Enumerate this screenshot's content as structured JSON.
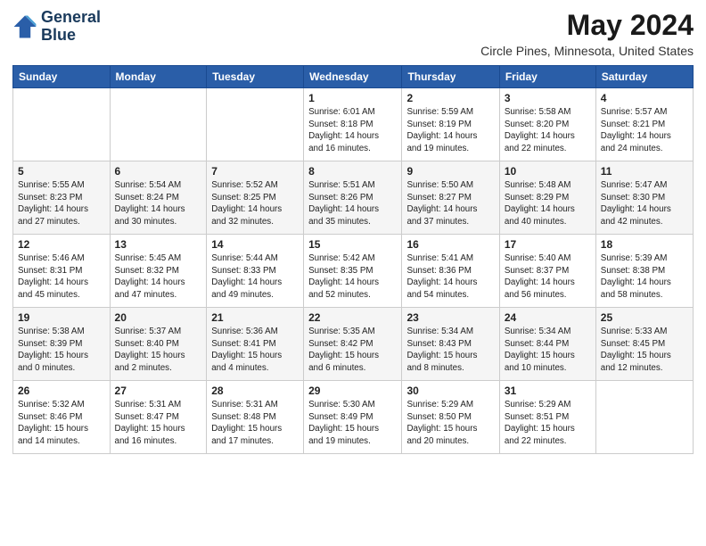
{
  "logo": {
    "line1": "General",
    "line2": "Blue"
  },
  "title": "May 2024",
  "subtitle": "Circle Pines, Minnesota, United States",
  "days_of_week": [
    "Sunday",
    "Monday",
    "Tuesday",
    "Wednesday",
    "Thursday",
    "Friday",
    "Saturday"
  ],
  "weeks": [
    [
      {
        "day": "",
        "info": ""
      },
      {
        "day": "",
        "info": ""
      },
      {
        "day": "",
        "info": ""
      },
      {
        "day": "1",
        "info": "Sunrise: 6:01 AM\nSunset: 8:18 PM\nDaylight: 14 hours\nand 16 minutes."
      },
      {
        "day": "2",
        "info": "Sunrise: 5:59 AM\nSunset: 8:19 PM\nDaylight: 14 hours\nand 19 minutes."
      },
      {
        "day": "3",
        "info": "Sunrise: 5:58 AM\nSunset: 8:20 PM\nDaylight: 14 hours\nand 22 minutes."
      },
      {
        "day": "4",
        "info": "Sunrise: 5:57 AM\nSunset: 8:21 PM\nDaylight: 14 hours\nand 24 minutes."
      }
    ],
    [
      {
        "day": "5",
        "info": "Sunrise: 5:55 AM\nSunset: 8:23 PM\nDaylight: 14 hours\nand 27 minutes."
      },
      {
        "day": "6",
        "info": "Sunrise: 5:54 AM\nSunset: 8:24 PM\nDaylight: 14 hours\nand 30 minutes."
      },
      {
        "day": "7",
        "info": "Sunrise: 5:52 AM\nSunset: 8:25 PM\nDaylight: 14 hours\nand 32 minutes."
      },
      {
        "day": "8",
        "info": "Sunrise: 5:51 AM\nSunset: 8:26 PM\nDaylight: 14 hours\nand 35 minutes."
      },
      {
        "day": "9",
        "info": "Sunrise: 5:50 AM\nSunset: 8:27 PM\nDaylight: 14 hours\nand 37 minutes."
      },
      {
        "day": "10",
        "info": "Sunrise: 5:48 AM\nSunset: 8:29 PM\nDaylight: 14 hours\nand 40 minutes."
      },
      {
        "day": "11",
        "info": "Sunrise: 5:47 AM\nSunset: 8:30 PM\nDaylight: 14 hours\nand 42 minutes."
      }
    ],
    [
      {
        "day": "12",
        "info": "Sunrise: 5:46 AM\nSunset: 8:31 PM\nDaylight: 14 hours\nand 45 minutes."
      },
      {
        "day": "13",
        "info": "Sunrise: 5:45 AM\nSunset: 8:32 PM\nDaylight: 14 hours\nand 47 minutes."
      },
      {
        "day": "14",
        "info": "Sunrise: 5:44 AM\nSunset: 8:33 PM\nDaylight: 14 hours\nand 49 minutes."
      },
      {
        "day": "15",
        "info": "Sunrise: 5:42 AM\nSunset: 8:35 PM\nDaylight: 14 hours\nand 52 minutes."
      },
      {
        "day": "16",
        "info": "Sunrise: 5:41 AM\nSunset: 8:36 PM\nDaylight: 14 hours\nand 54 minutes."
      },
      {
        "day": "17",
        "info": "Sunrise: 5:40 AM\nSunset: 8:37 PM\nDaylight: 14 hours\nand 56 minutes."
      },
      {
        "day": "18",
        "info": "Sunrise: 5:39 AM\nSunset: 8:38 PM\nDaylight: 14 hours\nand 58 minutes."
      }
    ],
    [
      {
        "day": "19",
        "info": "Sunrise: 5:38 AM\nSunset: 8:39 PM\nDaylight: 15 hours\nand 0 minutes."
      },
      {
        "day": "20",
        "info": "Sunrise: 5:37 AM\nSunset: 8:40 PM\nDaylight: 15 hours\nand 2 minutes."
      },
      {
        "day": "21",
        "info": "Sunrise: 5:36 AM\nSunset: 8:41 PM\nDaylight: 15 hours\nand 4 minutes."
      },
      {
        "day": "22",
        "info": "Sunrise: 5:35 AM\nSunset: 8:42 PM\nDaylight: 15 hours\nand 6 minutes."
      },
      {
        "day": "23",
        "info": "Sunrise: 5:34 AM\nSunset: 8:43 PM\nDaylight: 15 hours\nand 8 minutes."
      },
      {
        "day": "24",
        "info": "Sunrise: 5:34 AM\nSunset: 8:44 PM\nDaylight: 15 hours\nand 10 minutes."
      },
      {
        "day": "25",
        "info": "Sunrise: 5:33 AM\nSunset: 8:45 PM\nDaylight: 15 hours\nand 12 minutes."
      }
    ],
    [
      {
        "day": "26",
        "info": "Sunrise: 5:32 AM\nSunset: 8:46 PM\nDaylight: 15 hours\nand 14 minutes."
      },
      {
        "day": "27",
        "info": "Sunrise: 5:31 AM\nSunset: 8:47 PM\nDaylight: 15 hours\nand 16 minutes."
      },
      {
        "day": "28",
        "info": "Sunrise: 5:31 AM\nSunset: 8:48 PM\nDaylight: 15 hours\nand 17 minutes."
      },
      {
        "day": "29",
        "info": "Sunrise: 5:30 AM\nSunset: 8:49 PM\nDaylight: 15 hours\nand 19 minutes."
      },
      {
        "day": "30",
        "info": "Sunrise: 5:29 AM\nSunset: 8:50 PM\nDaylight: 15 hours\nand 20 minutes."
      },
      {
        "day": "31",
        "info": "Sunrise: 5:29 AM\nSunset: 8:51 PM\nDaylight: 15 hours\nand 22 minutes."
      },
      {
        "day": "",
        "info": ""
      }
    ]
  ]
}
